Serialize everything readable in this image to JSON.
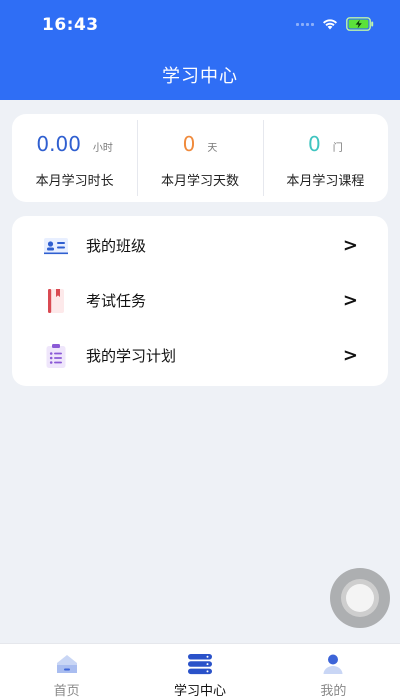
{
  "status_bar": {
    "time": "16:43"
  },
  "header": {
    "title": "学习中心"
  },
  "stats": [
    {
      "value": "0.00",
      "unit": "小时",
      "label": "本月学习时长",
      "color": "#2f5fd0"
    },
    {
      "value": "0",
      "unit": "天",
      "label": "本月学习天数",
      "color": "#f08a3c"
    },
    {
      "value": "0",
      "unit": "门",
      "label": "本月学习课程",
      "color": "#3fc4c0"
    }
  ],
  "menu": [
    {
      "label": "我的班级",
      "icon": "id-card-icon",
      "arrow": ">"
    },
    {
      "label": "考试任务",
      "icon": "notebook-icon",
      "arrow": ">"
    },
    {
      "label": "我的学习计划",
      "icon": "clipboard-list-icon",
      "arrow": ">"
    }
  ],
  "tabbar": [
    {
      "label": "首页",
      "icon": "home-icon",
      "active": false
    },
    {
      "label": "学习中心",
      "icon": "layers-icon",
      "active": true
    },
    {
      "label": "我的",
      "icon": "user-icon",
      "active": false
    }
  ],
  "colors": {
    "primary": "#2f6ef5",
    "background": "#eef1f6"
  }
}
